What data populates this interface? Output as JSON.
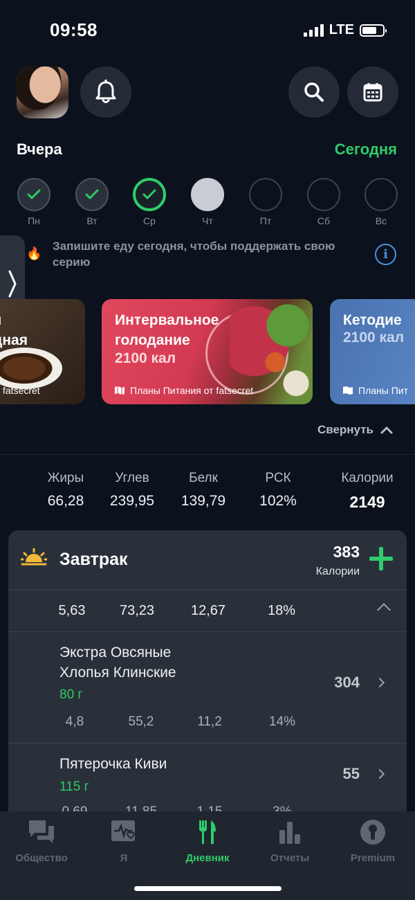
{
  "status_bar": {
    "time": "09:58",
    "network": "LTE"
  },
  "header": {
    "yesterday_label": "Вчера",
    "today_label": "Сегодня"
  },
  "week": {
    "days": [
      {
        "label": "Пн",
        "state": "done"
      },
      {
        "label": "Вт",
        "state": "done"
      },
      {
        "label": "Ср",
        "state": "active"
      },
      {
        "label": "Чт",
        "state": "current"
      },
      {
        "label": "Пт",
        "state": "empty"
      },
      {
        "label": "Сб",
        "state": "empty"
      },
      {
        "label": "Вс",
        "state": "empty"
      }
    ]
  },
  "streak": {
    "text": "Запишите еду сегодня, чтобы поддержать свою серию"
  },
  "plans": [
    {
      "title": "я\nдная",
      "calories": "",
      "footer": "fatsecret"
    },
    {
      "title": "Интервальное\nголодание",
      "calories": "2100 кал",
      "footer": "Планы Питания от fatsecret"
    },
    {
      "title": "Кетодие",
      "calories": "2100 кал",
      "footer": "Планы Пит"
    }
  ],
  "collapse_label": "Свернуть",
  "totals": {
    "headers": [
      "Жиры",
      "Углев",
      "Белк",
      "РСК",
      "Калории"
    ],
    "values": [
      "66,28",
      "239,95",
      "139,79",
      "102%",
      "2149"
    ]
  },
  "meal": {
    "name": "Завтрак",
    "calories": "383",
    "calories_label": "Калории",
    "values": [
      "5,63",
      "73,23",
      "12,67",
      "18%"
    ],
    "items": [
      {
        "name": "Экстра Овсяные\nХлопья Клинские",
        "qty": "80 г",
        "calories": "304",
        "values": [
          "4,8",
          "55,2",
          "11,2",
          "14%"
        ]
      },
      {
        "name": "Пятерочка Киви",
        "qty": "115 г",
        "calories": "55",
        "values": [
          "0,69",
          "11,85",
          "1,15",
          "3%"
        ]
      }
    ]
  },
  "tabs": [
    {
      "label": "Общество"
    },
    {
      "label": "Я"
    },
    {
      "label": "Дневник"
    },
    {
      "label": "Отчеты"
    },
    {
      "label": "Premium"
    }
  ],
  "colors": {
    "accent": "#2ecc6a",
    "background": "#0b121d",
    "panel": "#2a3039",
    "info": "#4a90e2"
  }
}
